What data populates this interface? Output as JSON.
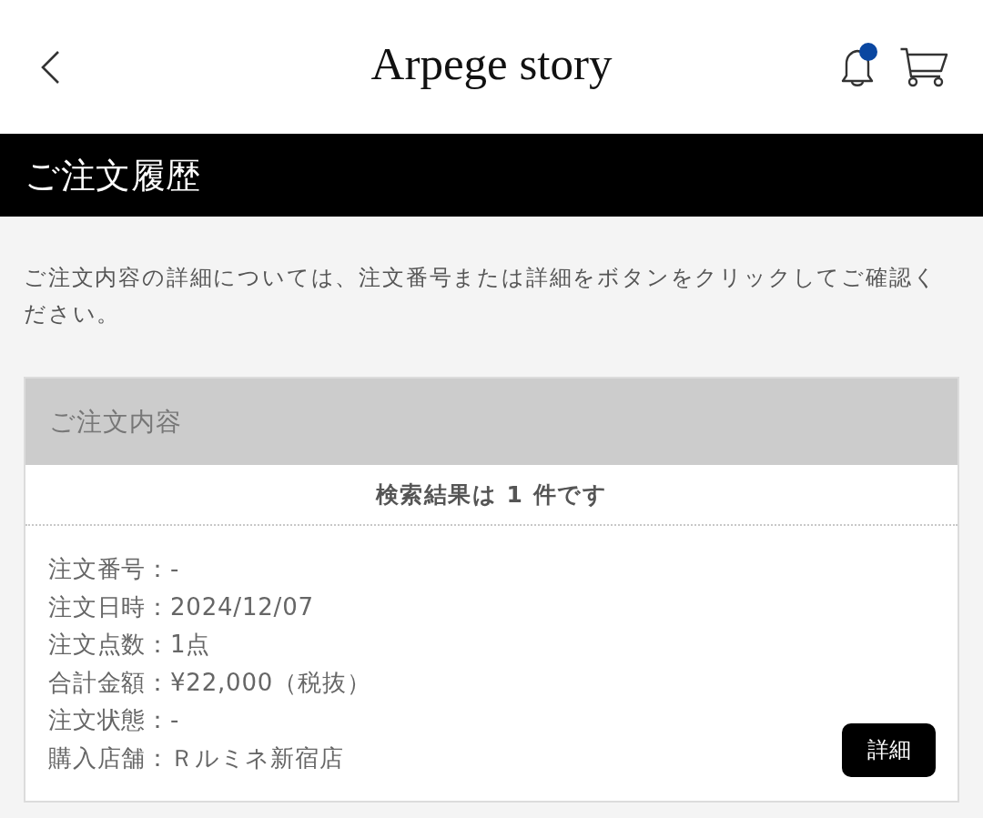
{
  "header": {
    "title": "Arpege story",
    "notification_unread": true
  },
  "page_title": "ご注文履歴",
  "description": "ご注文内容の詳細については、注文番号または詳細をボタンをクリックしてご確認ください。",
  "order_panel": {
    "heading": "ご注文内容",
    "result_count": "検索結果は 1 件です",
    "details": [
      "注文番号：-",
      "注文日時：2024/12/07",
      "注文点数：1点",
      "合計金額：¥22,000（税抜）",
      "注文状態：-",
      "購入店舗：Ｒルミネ新宿店"
    ],
    "detail_button": "詳細"
  }
}
